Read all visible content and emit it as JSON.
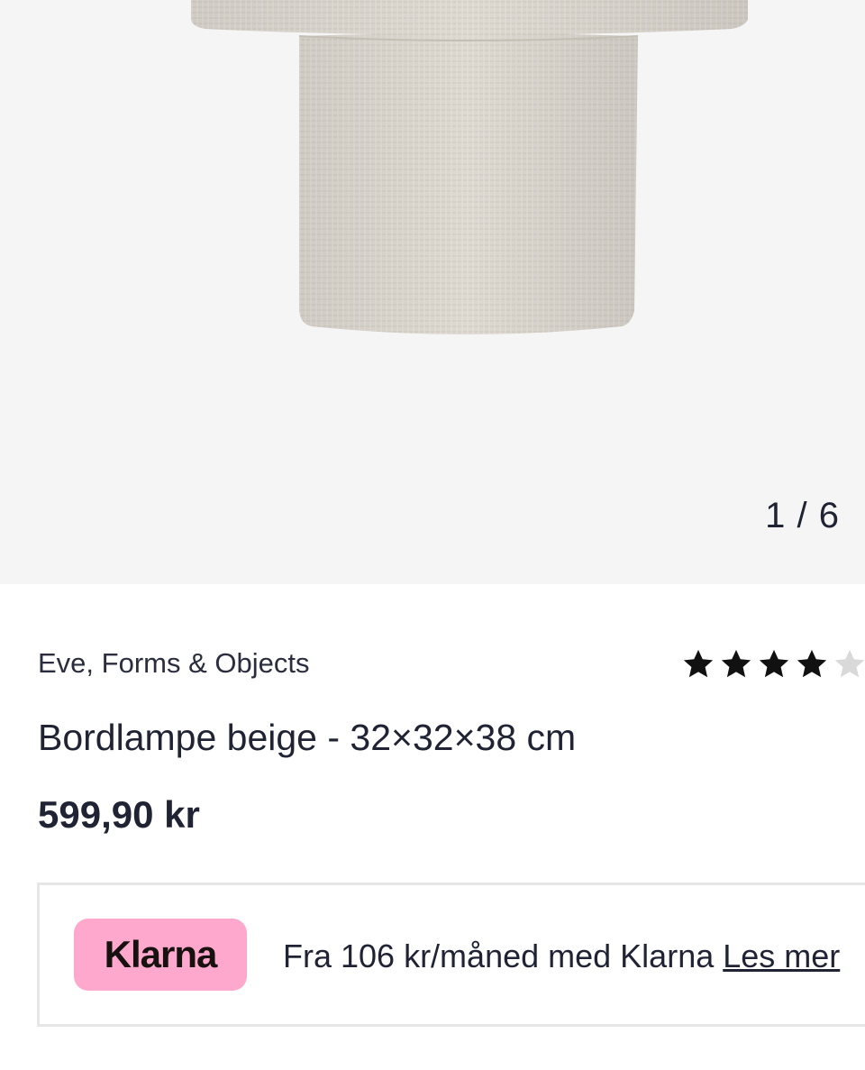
{
  "gallery": {
    "counter": "1 / 6",
    "image_alt": "lamp-product-image",
    "image_current": 1,
    "image_total": 6
  },
  "product": {
    "brand": "Eve, Forms & Objects",
    "title": "Bordlampe beige - 32×32×38 cm",
    "price": "599,90 kr",
    "rating": 4,
    "rating_max": 5
  },
  "klarna": {
    "logo_text": "Klarna",
    "message": "Fra 106 kr/måned med Klarna",
    "link": "Les mer"
  },
  "colors": {
    "klarna_pink": "#ffa8cd",
    "star_filled": "#111111",
    "star_empty": "#d9d9d9",
    "gallery_bg": "#f5f5f5"
  }
}
